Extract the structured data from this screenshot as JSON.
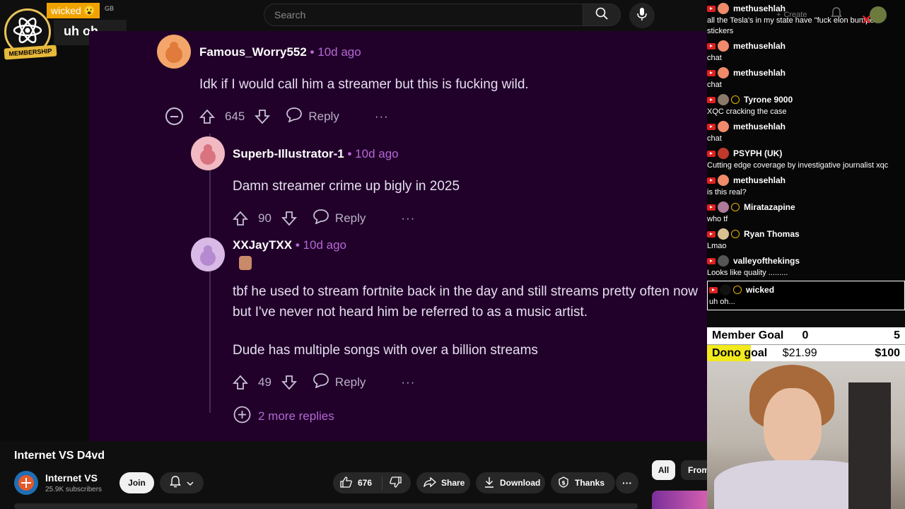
{
  "header": {
    "search_placeholder": "Search",
    "overlay_name": "wicked",
    "overlay_tag": "GB",
    "overlay_message": "uh oh...",
    "membership_label": "MEMBERSHIP",
    "create_label": "Create"
  },
  "comments": [
    {
      "user": "Famous_Worry552",
      "sep": "•",
      "time": "10d ago",
      "text": "Idk if I would call him a streamer but this is fucking wild.",
      "votes": "645",
      "reply": "Reply",
      "more": "···"
    },
    {
      "user": "Superb-Illustrator-1",
      "sep": "•",
      "time": "10d ago",
      "text": "Damn streamer crime up bigly in 2025",
      "votes": "90",
      "reply": "Reply",
      "more": "···"
    },
    {
      "user": "XXJayTXX",
      "sep": "•",
      "time": "10d ago",
      "line1": "tbf he used to stream fortnite back in the day and still streams pretty often now",
      "line2": "but I've never not heard him be referred to as a music artist.",
      "line3": "Dude has multiple songs with over a billion streams",
      "votes": "49",
      "reply": "Reply",
      "more": "···"
    }
  ],
  "more_replies": "2 more replies",
  "video": {
    "title": "Internet VS D4vd",
    "channel": "Internet VS",
    "subscribers": "25.9K subscribers",
    "join": "Join",
    "likes": "676",
    "share": "Share",
    "download": "Download",
    "thanks": "Thanks",
    "more": "···",
    "chip_all": "All",
    "chip_from": "From"
  },
  "chat": [
    {
      "name": "methusehlah",
      "text": "all the Tesla's in my state have \"fuck elon bumper stickers"
    },
    {
      "name": "methusehlah",
      "text": "chat"
    },
    {
      "name": "methusehlah",
      "text": "chat"
    },
    {
      "name": "Tyrone 9000",
      "text": "XQC cracking the case"
    },
    {
      "name": "methusehlah",
      "text": "chat"
    },
    {
      "name": "PSYPH (UK)",
      "text": "Cutting edge coverage by investigative journalist xqc"
    },
    {
      "name": "methusehlah",
      "text": "is this real?"
    },
    {
      "name": "Miratazapine",
      "text": "who tf"
    },
    {
      "name": "Ryan Thomas",
      "text": "Lmao"
    },
    {
      "name": "valleyofthekings",
      "text": "Looks like quality ........."
    },
    {
      "name": "wicked",
      "text": "uh oh..."
    }
  ],
  "goals": {
    "member_label": "Member Goal",
    "member_current": "0",
    "member_target": "5",
    "dono_label": "Dono goal",
    "dono_current": "$21.99",
    "dono_target": "$100",
    "dono_progress": 0.22
  },
  "colors": {
    "stage_bg": "#21002a",
    "accent_purple": "#b469d4",
    "dono_fill": "#f2ea1d"
  }
}
